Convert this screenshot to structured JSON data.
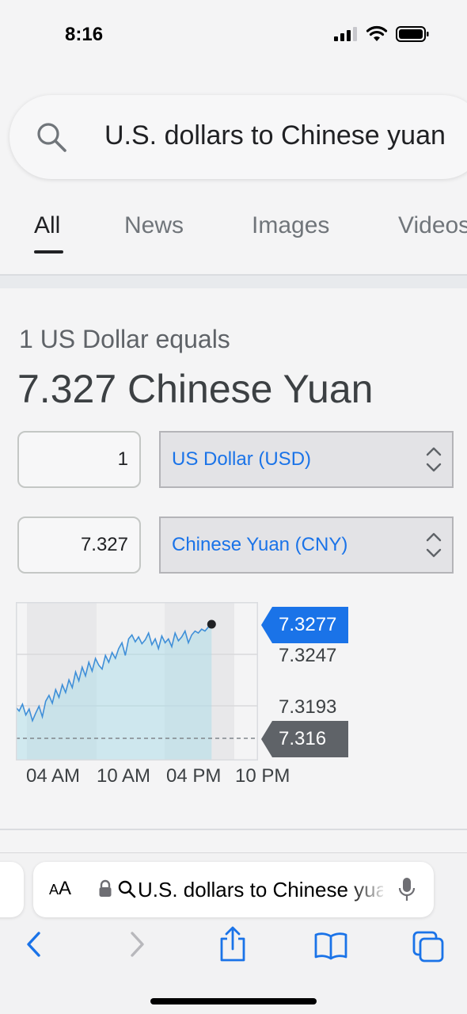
{
  "status_bar": {
    "time": "8:16"
  },
  "search": {
    "query": "U.S. dollars to Chinese yuan"
  },
  "tabs": [
    {
      "label": "All",
      "active": true
    },
    {
      "label": "News",
      "active": false
    },
    {
      "label": "Images",
      "active": false
    },
    {
      "label": "Videos",
      "active": false
    }
  ],
  "converter": {
    "equals_label": "1 US Dollar equals",
    "result": "7.327 Chinese Yuan",
    "from": {
      "amount": "1",
      "currency": "US Dollar (USD)"
    },
    "to": {
      "amount": "7.327",
      "currency": "Chinese Yuan (CNY)"
    }
  },
  "chart_data": {
    "type": "line",
    "x_ticks": [
      "04 AM",
      "10 AM",
      "04 PM",
      "10 PM"
    ],
    "y_ticks": [
      "7.3247",
      "7.3193"
    ],
    "high_badge": "7.3277",
    "low_badge": "7.316",
    "ylim": [
      7.316,
      7.3277
    ],
    "x_range": [
      1.3,
      23.2
    ],
    "series": [
      {
        "x": [
          1.3,
          1.6,
          1.9,
          2.2,
          2.5,
          2.8,
          3.1,
          3.4,
          3.7,
          4.0,
          4.3,
          4.6,
          4.9,
          5.2,
          5.5,
          5.8,
          6.1,
          6.4,
          6.7,
          7.0,
          7.3,
          7.6,
          7.9,
          8.2,
          8.5,
          8.8,
          9.1,
          9.4,
          9.7,
          10.0,
          10.3,
          10.6,
          10.9,
          11.2,
          11.5,
          11.8,
          12.1,
          12.4,
          12.7,
          13.0,
          13.3,
          13.6,
          13.9,
          14.2,
          14.5,
          14.8,
          15.1,
          15.4,
          15.7,
          16.0,
          16.3,
          16.6,
          16.9,
          17.2,
          17.5,
          17.8,
          18.1,
          18.4,
          18.7,
          19.0
        ],
        "y": [
          7.3192,
          7.3188,
          7.3195,
          7.3184,
          7.319,
          7.3178,
          7.3186,
          7.3193,
          7.3182,
          7.3198,
          7.3204,
          7.3196,
          7.321,
          7.3202,
          7.3215,
          7.3207,
          7.322,
          7.3212,
          7.3228,
          7.3219,
          7.3233,
          7.3224,
          7.3238,
          7.3229,
          7.3242,
          7.3235,
          7.3231,
          7.3245,
          7.3238,
          7.3248,
          7.3242,
          7.3252,
          7.3258,
          7.3245,
          7.3262,
          7.3266,
          7.3259,
          7.3264,
          7.3257,
          7.3261,
          7.3268,
          7.3256,
          7.3262,
          7.3252,
          7.3265,
          7.3258,
          7.3262,
          7.3254,
          7.3268,
          7.326,
          7.3264,
          7.327,
          7.3258,
          7.3266,
          7.327,
          7.3268,
          7.3272,
          7.327,
          7.3274,
          7.3277
        ]
      }
    ]
  }
}
